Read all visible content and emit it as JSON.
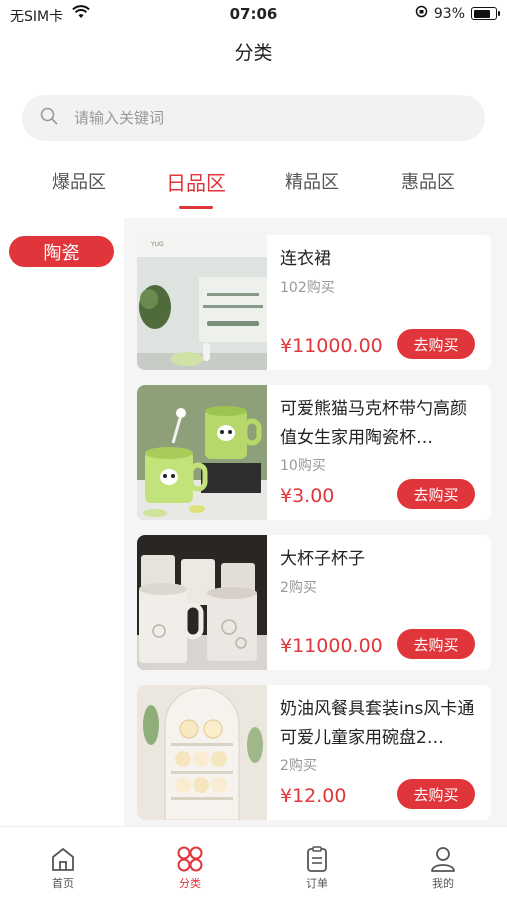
{
  "status": {
    "carrier": "无SIM卡",
    "time": "07:06",
    "battery": "93%",
    "battery_level": 0.93
  },
  "page_title": "分类",
  "search": {
    "placeholder": "请输入关键词"
  },
  "tabs": [
    {
      "label": "爆品区",
      "active": false
    },
    {
      "label": "日品区",
      "active": true
    },
    {
      "label": "精品区",
      "active": false
    },
    {
      "label": "惠品区",
      "active": false
    }
  ],
  "sidebar": {
    "items": [
      {
        "label": "陶瓷",
        "active": true
      }
    ]
  },
  "products": [
    {
      "name": "连衣裙",
      "sold": "102购买",
      "price": "¥11000.00",
      "buy_label": "去购买"
    },
    {
      "name": "可爱熊猫马克杯带勺高颜值女生家用陶瓷杯…",
      "sold": "10购买",
      "price": "¥3.00",
      "buy_label": "去购买"
    },
    {
      "name": "大杯子杯子",
      "sold": "2购买",
      "price": "¥11000.00",
      "buy_label": "去购买"
    },
    {
      "name": "奶油风餐具套装ins风卡通可爱儿童家用碗盘2…",
      "sold": "2购买",
      "price": "¥12.00",
      "buy_label": "去购买"
    }
  ],
  "tabbar": [
    {
      "label": "首页",
      "icon": "home-icon",
      "active": false
    },
    {
      "label": "分类",
      "icon": "category-icon",
      "active": true
    },
    {
      "label": "订单",
      "icon": "order-icon",
      "active": false
    },
    {
      "label": "我的",
      "icon": "user-icon",
      "active": false
    }
  ],
  "colors": {
    "accent": "#e0363b",
    "background": "#f5f5f5"
  }
}
